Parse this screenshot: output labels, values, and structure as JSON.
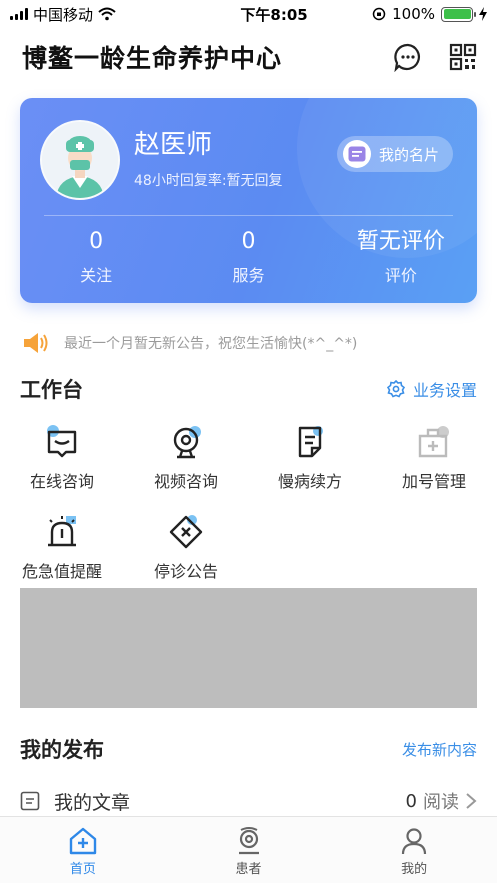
{
  "status_bar": {
    "carrier": "中国移动",
    "time": "下午8:05",
    "battery": "100%"
  },
  "header": {
    "title": "博鳌一龄生命养护中心",
    "icons": [
      "chat-icon",
      "qr-code-icon"
    ]
  },
  "profile": {
    "name": "赵医师",
    "reply_rate": "48小时回复率:暂无回复",
    "card_button": "我的名片",
    "stats": [
      {
        "value": "0",
        "label": "关注"
      },
      {
        "value": "0",
        "label": "服务"
      },
      {
        "value": "暂无评价",
        "label": "评价"
      }
    ]
  },
  "notice": {
    "text": "最近一个月暂无新公告，祝您生活愉快(*^_^*)"
  },
  "workbench": {
    "title": "工作台",
    "settings_label": "业务设置",
    "items": [
      {
        "label": "在线咨询",
        "icon": "online-consult-icon"
      },
      {
        "label": "视频咨询",
        "icon": "video-consult-icon"
      },
      {
        "label": "慢病续方",
        "icon": "prescription-icon"
      },
      {
        "label": "加号管理",
        "icon": "add-appointment-icon"
      },
      {
        "label": "危急值提醒",
        "icon": "alarm-icon"
      },
      {
        "label": "停诊公告",
        "icon": "suspend-notice-icon"
      }
    ]
  },
  "publish": {
    "title": "我的发布",
    "new_content_label": "发布新内容",
    "articles": {
      "label": "我的文章",
      "count": "0",
      "unit": "阅读"
    }
  },
  "tabs": [
    {
      "label": "首页",
      "icon": "home-icon",
      "active": true
    },
    {
      "label": "患者",
      "icon": "patient-icon",
      "active": false
    },
    {
      "label": "我的",
      "icon": "profile-icon",
      "active": false
    }
  ],
  "colors": {
    "accent": "#3a8ee6",
    "card_start": "#6b8ff5",
    "card_end": "#5aa0f4",
    "banner": "#bdbdbd"
  }
}
